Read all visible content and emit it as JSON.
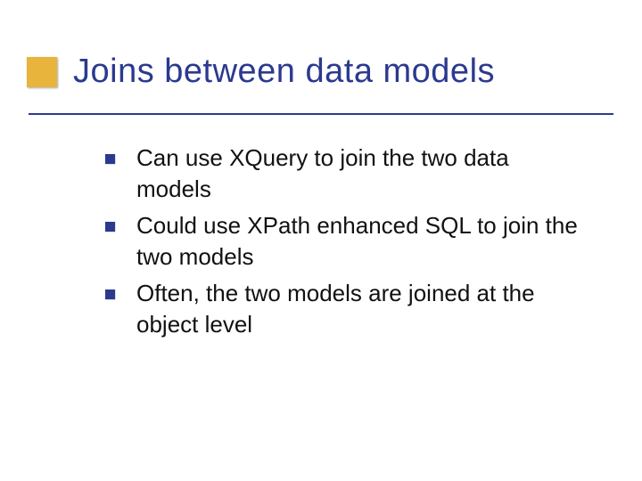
{
  "slide": {
    "title": "Joins between data models",
    "bullets": [
      {
        "text": "Can use XQuery to join the two data models"
      },
      {
        "text": "Could use XPath enhanced SQL to join the two models"
      },
      {
        "text": "Often, the two models are joined at the object level"
      }
    ]
  },
  "colors": {
    "accent_gold": "#e8b43c",
    "accent_blue": "#2b3a8f"
  }
}
